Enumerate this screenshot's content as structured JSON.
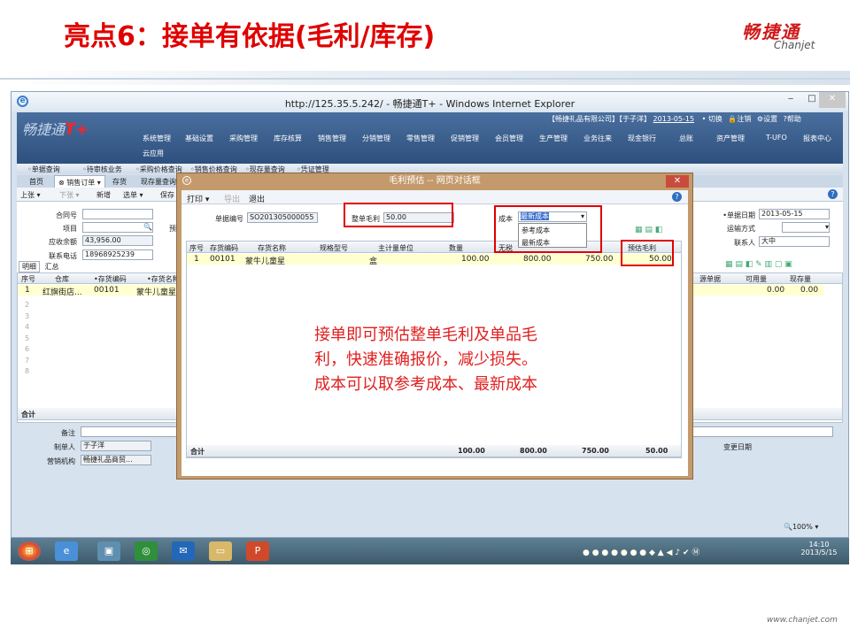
{
  "slide": {
    "title": "亮点6：接单有依据(毛利/库存)",
    "logo_cn": "畅捷通",
    "logo_en": "Chanjet",
    "footer": "www.chanjet.com"
  },
  "browser": {
    "title": "http://125.35.5.242/ - 畅捷通T+ - Windows Internet Explorer",
    "ie_glyph": "e"
  },
  "app": {
    "logo": "畅捷通",
    "logo_t": "T+",
    "top_info": "【畅捷礼品有限公司】【于子洋】",
    "date": "2013-05-15",
    "switch": "切换",
    "logout": "注销",
    "settings": "设置",
    "help": "帮助",
    "menu": [
      "系统管理",
      "基础设置",
      "采购管理",
      "库存核算",
      "销售管理",
      "分销管理",
      "零售管理",
      "促销管理",
      "会员管理",
      "生产管理",
      "业务往来",
      "现金银行",
      "总账",
      "资产管理",
      "T-UFO",
      "报表中心"
    ],
    "menu2": "云应用",
    "quicklinks": [
      "单据查询",
      "待审核业务",
      "采购价格查询",
      "销售价格查询",
      "现存量查询",
      "凭证管理"
    ],
    "tabs": [
      "首页",
      "销售订单",
      "存货",
      "现存量查询"
    ],
    "toolbar": [
      "上张",
      "下张",
      "新增",
      "选单",
      "保存"
    ],
    "form": {
      "contract_label": "合同号",
      "project_label": "项目",
      "receivable_label": "应收余额",
      "receivable_value": "43,956.00",
      "phone_label": "联系电话",
      "phone_value": "18968925239",
      "pre_label": "预",
      "date_label": "单据日期",
      "date_value": "2013-05-15",
      "transport_label": "运输方式",
      "contact_label": "联系人",
      "contact_value": "大中"
    },
    "subtabs": [
      "明细",
      "汇总"
    ],
    "grid": {
      "headers": [
        "序号",
        "仓库",
        "存货编码",
        "存货名称"
      ],
      "right_headers": [
        "源单据",
        "可用量",
        "现存量"
      ],
      "row": {
        "no": "1",
        "warehouse": "红旗街店...",
        "code": "00101",
        "name": "蒙牛儿童星",
        "avail": "0.00",
        "stock": "0.00"
      },
      "rownums": [
        "2",
        "3",
        "4",
        "5",
        "6",
        "7",
        "8"
      ],
      "total_label": "合计"
    },
    "bottom": {
      "remark_label": "备注",
      "maker_label": "制单人",
      "maker_value": "于子洋",
      "org_label": "营销机构",
      "org_value": "畅捷礼品商贸...",
      "change_date_label": "变更日期",
      "zoom": "100%"
    }
  },
  "dialog": {
    "title": "毛利预估 -- 网页对话框",
    "toolbar": [
      "打印",
      "导出",
      "退出"
    ],
    "order_label": "单据编号",
    "order_value": "SO201305000055",
    "margin_label": "整单毛利",
    "margin_value": "50.00",
    "cost_label": "成本",
    "cost_selected": "最新成本",
    "cost_options": [
      "参考成本",
      "最新成本"
    ],
    "headers": [
      "序号",
      "存货编码",
      "存货名称",
      "规格型号",
      "主计量单位",
      "数量",
      "无税",
      "",
      "预估毛利"
    ],
    "row": {
      "no": "1",
      "code": "00101",
      "name": "蒙牛儿童星",
      "spec": "",
      "unit": "盒",
      "qty": "100.00",
      "amount": "800.00",
      "cost": "750.00",
      "margin": "50.00"
    },
    "total": {
      "label": "合计",
      "qty": "100.00",
      "amount": "800.00",
      "cost": "750.00",
      "margin": "50.00"
    }
  },
  "note": {
    "line1": "接单即可预估整单毛利及单品毛",
    "line2": "利，快速准确报价，减少损失。",
    "line3": "成本可以取参考成本、最新成本"
  },
  "taskbar": {
    "time": "14:10",
    "date": "2013/5/15"
  }
}
